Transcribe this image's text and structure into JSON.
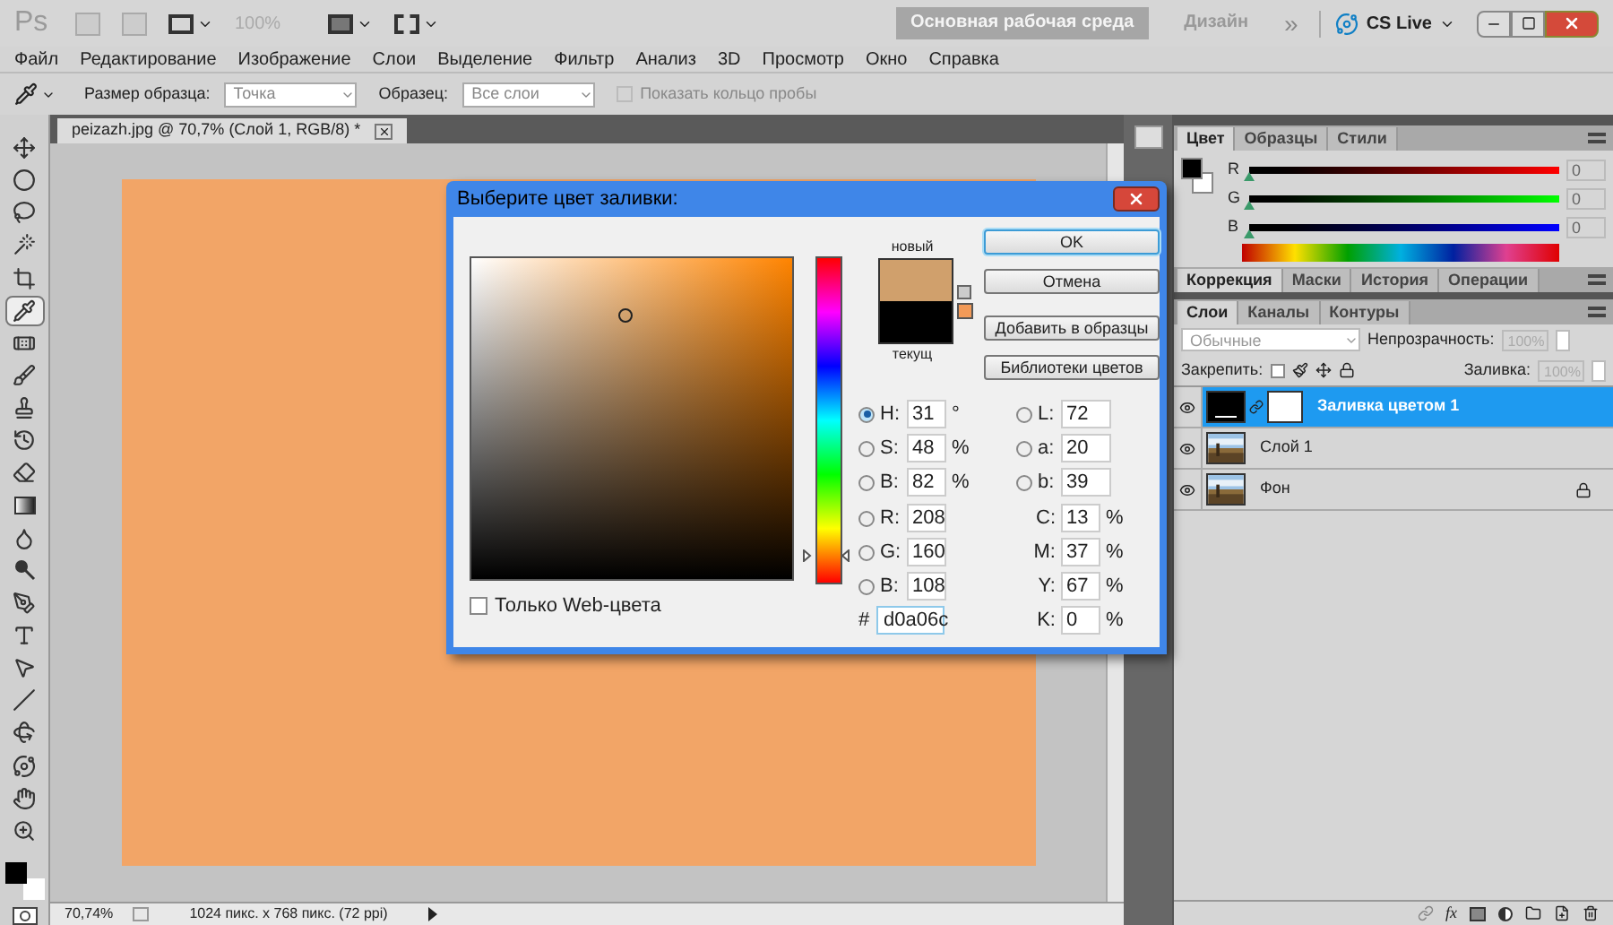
{
  "app_bar": {
    "logo": "Ps",
    "zoom": "100%",
    "workspaces": [
      {
        "label": "Основная рабочая среда",
        "selected": true
      },
      {
        "label": "Дизайн",
        "selected": false
      }
    ],
    "more": "»",
    "cs_live": "CS Live"
  },
  "menu": [
    "Файл",
    "Редактирование",
    "Изображение",
    "Слои",
    "Выделение",
    "Фильтр",
    "Анализ",
    "3D",
    "Просмотр",
    "Окно",
    "Справка"
  ],
  "options_bar": {
    "sample_size_label": "Размер образца:",
    "sample_size": "Точка",
    "sample_label": "Образец:",
    "sample": "Все слои",
    "ring": {
      "label": "Показать кольцо пробы",
      "checked": false,
      "disabled": true
    }
  },
  "tools": [
    {
      "kind": "move",
      "selected": false
    },
    {
      "kind": "marquee",
      "selected": false
    },
    {
      "kind": "lasso",
      "selected": false
    },
    {
      "kind": "wand",
      "selected": false
    },
    {
      "kind": "crop",
      "selected": false
    },
    {
      "kind": "eyedropper",
      "selected": true
    },
    {
      "kind": "heal",
      "selected": false
    },
    {
      "kind": "brush",
      "selected": false
    },
    {
      "kind": "stamp",
      "selected": false
    },
    {
      "kind": "history",
      "selected": false
    },
    {
      "kind": "eraser",
      "selected": false
    },
    {
      "kind": "gradient",
      "selected": false
    },
    {
      "kind": "blur",
      "selected": false
    },
    {
      "kind": "dodge",
      "selected": false
    },
    {
      "kind": "pen",
      "selected": false
    },
    {
      "kind": "type",
      "selected": false
    },
    {
      "kind": "select",
      "selected": false
    },
    {
      "kind": "line",
      "selected": false
    },
    {
      "kind": "rotate3d",
      "selected": false
    },
    {
      "kind": "orbit3d",
      "selected": false
    },
    {
      "kind": "hand",
      "selected": false
    },
    {
      "kind": "zoom",
      "selected": false
    }
  ],
  "document": {
    "tab": "peizazh.jpg @ 70,7% (Слой 1, RGB/8) *"
  },
  "status_bar": {
    "zoom": "70,74%",
    "info": "1024 пикс. x 768 пикс. (72 ppi)"
  },
  "dialog": {
    "title": "Выберите цвет заливки:",
    "new_label": "новый",
    "current_label": "текущ",
    "buttons": [
      {
        "label": "OK",
        "default": true
      },
      {
        "label": "Отмена",
        "default": false
      },
      {
        "label": "Добавить в образцы",
        "default": false
      },
      {
        "label": "Библиотеки цветов",
        "default": false
      }
    ],
    "web_only": {
      "label": "Только Web-цвета",
      "checked": false
    },
    "hsb_rgb": [
      {
        "label": "H:",
        "value": "31",
        "unit": "°",
        "selected": true
      },
      {
        "label": "S:",
        "value": "48",
        "unit": "%",
        "selected": false
      },
      {
        "label": "B:",
        "value": "82",
        "unit": "%",
        "selected": false
      },
      {
        "label": "R:",
        "value": "208",
        "selected": false
      },
      {
        "label": "G:",
        "value": "160",
        "selected": false
      },
      {
        "label": "B:",
        "value": "108",
        "selected": false
      }
    ],
    "hex": {
      "label": "#",
      "value": "d0a06c"
    },
    "lab": [
      {
        "label": "L:",
        "value": "72",
        "selected": false
      },
      {
        "label": "a:",
        "value": "20",
        "selected": false
      },
      {
        "label": "b:",
        "value": "39",
        "selected": false
      }
    ],
    "cmyk": [
      {
        "label": "C:",
        "value": "13",
        "unit": "%"
      },
      {
        "label": "M:",
        "value": "37",
        "unit": "%"
      },
      {
        "label": "Y:",
        "value": "67",
        "unit": "%"
      },
      {
        "label": "K:",
        "value": "0",
        "unit": "%"
      }
    ]
  },
  "color_panel": {
    "tabs": [
      {
        "label": "Цвет",
        "selected": true
      },
      {
        "label": "Образцы",
        "selected": false
      },
      {
        "label": "Стили",
        "selected": false
      }
    ],
    "channels": [
      {
        "label": "R",
        "value": "0",
        "level": 0
      },
      {
        "label": "G",
        "value": "0",
        "level": 0
      },
      {
        "label": "B",
        "value": "0",
        "level": 0
      }
    ]
  },
  "adjust_panel": {
    "tabs": [
      {
        "label": "Коррекция",
        "selected": true
      },
      {
        "label": "Маски",
        "selected": false
      },
      {
        "label": "История",
        "selected": false
      },
      {
        "label": "Операции",
        "selected": false
      }
    ]
  },
  "layers_panel": {
    "tabs": [
      {
        "label": "Слои",
        "selected": true
      },
      {
        "label": "Каналы",
        "selected": false
      },
      {
        "label": "Контуры",
        "selected": false
      }
    ],
    "blend_mode": "Обычные",
    "fx_button": "fx",
    "opacity_label": "Непрозрачность:",
    "opacity": "100%",
    "lock_label": "Закрепить:",
    "fill_label": "Заливка:",
    "fill": "100%",
    "layers": [
      {
        "name": "Заливка цветом 1",
        "kind": "fill",
        "selected": true,
        "visible": true,
        "locked": false
      },
      {
        "name": "Слой 1",
        "selected": false,
        "visible": true,
        "locked": false
      },
      {
        "name": "Фон",
        "selected": false,
        "visible": true,
        "locked": true
      }
    ]
  }
}
